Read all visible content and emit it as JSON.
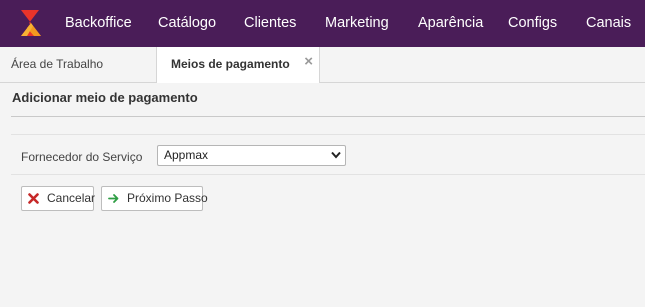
{
  "nav": {
    "items": [
      "Backoffice",
      "Catálogo",
      "Clientes",
      "Marketing",
      "Aparência",
      "Configs",
      "Canais"
    ]
  },
  "tabs": [
    {
      "label": "Área de Trabalho",
      "active": false
    },
    {
      "label": "Meios de pagamento",
      "active": true,
      "close": "×"
    }
  ],
  "page": {
    "title": "Adicionar meio de pagamento",
    "field_label": "Fornecedor do Serviço",
    "provider_selected": "Appmax"
  },
  "buttons": {
    "cancel": "Cancelar",
    "next": "Próximo Passo"
  },
  "icons": {
    "logo": "logo-icon",
    "cancel": "x-icon",
    "next": "arrow-right-icon",
    "select": "chevron-down-icon"
  },
  "colors": {
    "nav_bg": "#4a1d58",
    "logo_red": "#e8342a",
    "logo_orange": "#f39a1f",
    "cancel_red": "#c62828",
    "next_green": "#2e9e44"
  }
}
